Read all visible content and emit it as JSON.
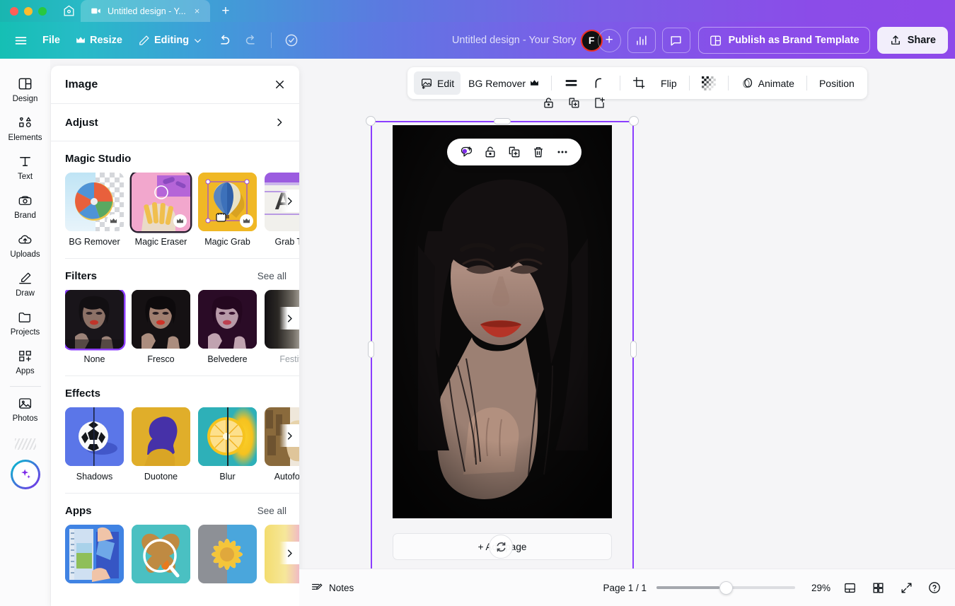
{
  "browser": {
    "home_icon": "home-icon",
    "tab": {
      "icon": "video-design-icon",
      "title": "Untitled design - Y...",
      "close": "×"
    },
    "new_tab": "+"
  },
  "header": {
    "menu_icon": "hamburger-icon",
    "file_label": "File",
    "resize_label": "Resize",
    "resize_icon": "crown-icon",
    "editing_label": "Editing",
    "editing_icon": "pencil-icon",
    "editing_caret": "chevron-down-icon",
    "undo_icon": "undo-icon",
    "redo_icon": "redo-icon",
    "cloud_icon": "cloud-check-icon",
    "doc_title": "Untitled design - Your Story",
    "avatar_initial": "F",
    "add_collaborator": "+",
    "insights_icon": "bar-chart-icon",
    "comment_icon": "comment-icon",
    "publish_label": "Publish as Brand Template",
    "publish_icon": "brand-template-icon",
    "share_label": "Share",
    "share_icon": "share-upload-icon",
    "accent_teal": "#15bfb4",
    "accent_purple": "#8e49ea"
  },
  "sidebar": {
    "items": [
      {
        "label": "Design",
        "icon": "design-layout-icon"
      },
      {
        "label": "Elements",
        "icon": "shapes-icon"
      },
      {
        "label": "Text",
        "icon": "text-t-icon"
      },
      {
        "label": "Brand",
        "icon": "brand-kit-icon"
      },
      {
        "label": "Uploads",
        "icon": "upload-cloud-icon"
      },
      {
        "label": "Draw",
        "icon": "draw-pen-icon"
      },
      {
        "label": "Projects",
        "icon": "folder-icon"
      },
      {
        "label": "Apps",
        "icon": "apps-grid-plus-icon"
      },
      {
        "label": "Photos",
        "icon": "photo-image-icon"
      }
    ],
    "magic_button": "magic-sparkle-icon"
  },
  "panel": {
    "title": "Image",
    "close_icon": "close-icon",
    "adjust_label": "Adjust",
    "adjust_chevron": "chevron-right-icon",
    "sections": [
      {
        "title": "Magic Studio",
        "see_all": null,
        "items": [
          {
            "label": "BG Remover",
            "pro": true,
            "selected": false
          },
          {
            "label": "Magic Eraser",
            "pro": true,
            "selected": true
          },
          {
            "label": "Magic Grab",
            "pro": true,
            "selected": false
          },
          {
            "label": "Grab Text",
            "pro": false,
            "selected": false
          }
        ]
      },
      {
        "title": "Filters",
        "see_all": "See all",
        "items": [
          {
            "label": "None",
            "pro": false,
            "selected": true
          },
          {
            "label": "Fresco",
            "pro": false,
            "selected": false
          },
          {
            "label": "Belvedere",
            "pro": false,
            "selected": false
          },
          {
            "label": "Festive",
            "pro": false,
            "selected": false
          }
        ]
      },
      {
        "title": "Effects",
        "see_all": null,
        "items": [
          {
            "label": "Shadows",
            "pro": false,
            "selected": false
          },
          {
            "label": "Duotone",
            "pro": false,
            "selected": false
          },
          {
            "label": "Blur",
            "pro": false,
            "selected": false
          },
          {
            "label": "Autofocus",
            "pro": false,
            "selected": false
          }
        ]
      },
      {
        "title": "Apps",
        "see_all": "See all",
        "items": [
          {
            "label": "",
            "pro": false,
            "selected": false
          },
          {
            "label": "",
            "pro": false,
            "selected": false
          },
          {
            "label": "",
            "pro": false,
            "selected": false
          },
          {
            "label": "",
            "pro": false,
            "selected": false
          }
        ]
      }
    ]
  },
  "toolbar": {
    "edit_label": "Edit",
    "edit_icon": "image-edit-icon",
    "bg_remover_label": "BG Remover",
    "bg_remover_crown": "crown-icon",
    "adjust_lines_icon": "adjust-lines-icon",
    "corner_icon": "corner-radius-icon",
    "crop_icon": "crop-icon",
    "flip_label": "Flip",
    "transparency_icon": "transparency-icon",
    "animate_label": "Animate",
    "animate_icon": "animate-icon",
    "position_label": "Position"
  },
  "object_tools": {
    "top": [
      "lock-icon",
      "duplicate-icon",
      "add-page-icon"
    ],
    "floating": [
      "comment-dot-icon",
      "lock-icon",
      "duplicate-icon",
      "trash-icon",
      "more-dots-icon"
    ]
  },
  "canvas": {
    "add_page_label": "+ Add page",
    "cursor_icon": "loading-spinner-icon",
    "selection_color": "#8b3dff"
  },
  "bottombar": {
    "notes_label": "Notes",
    "notes_icon": "notes-icon",
    "page_label": "Page 1 / 1",
    "zoom_value": "29%",
    "zoom_percent": 29,
    "grid_view_icon": "page-view-icon",
    "thumbnails_icon": "grid-view-icon",
    "fullscreen_icon": "fullscreen-icon",
    "help_icon": "help-circle-icon"
  }
}
